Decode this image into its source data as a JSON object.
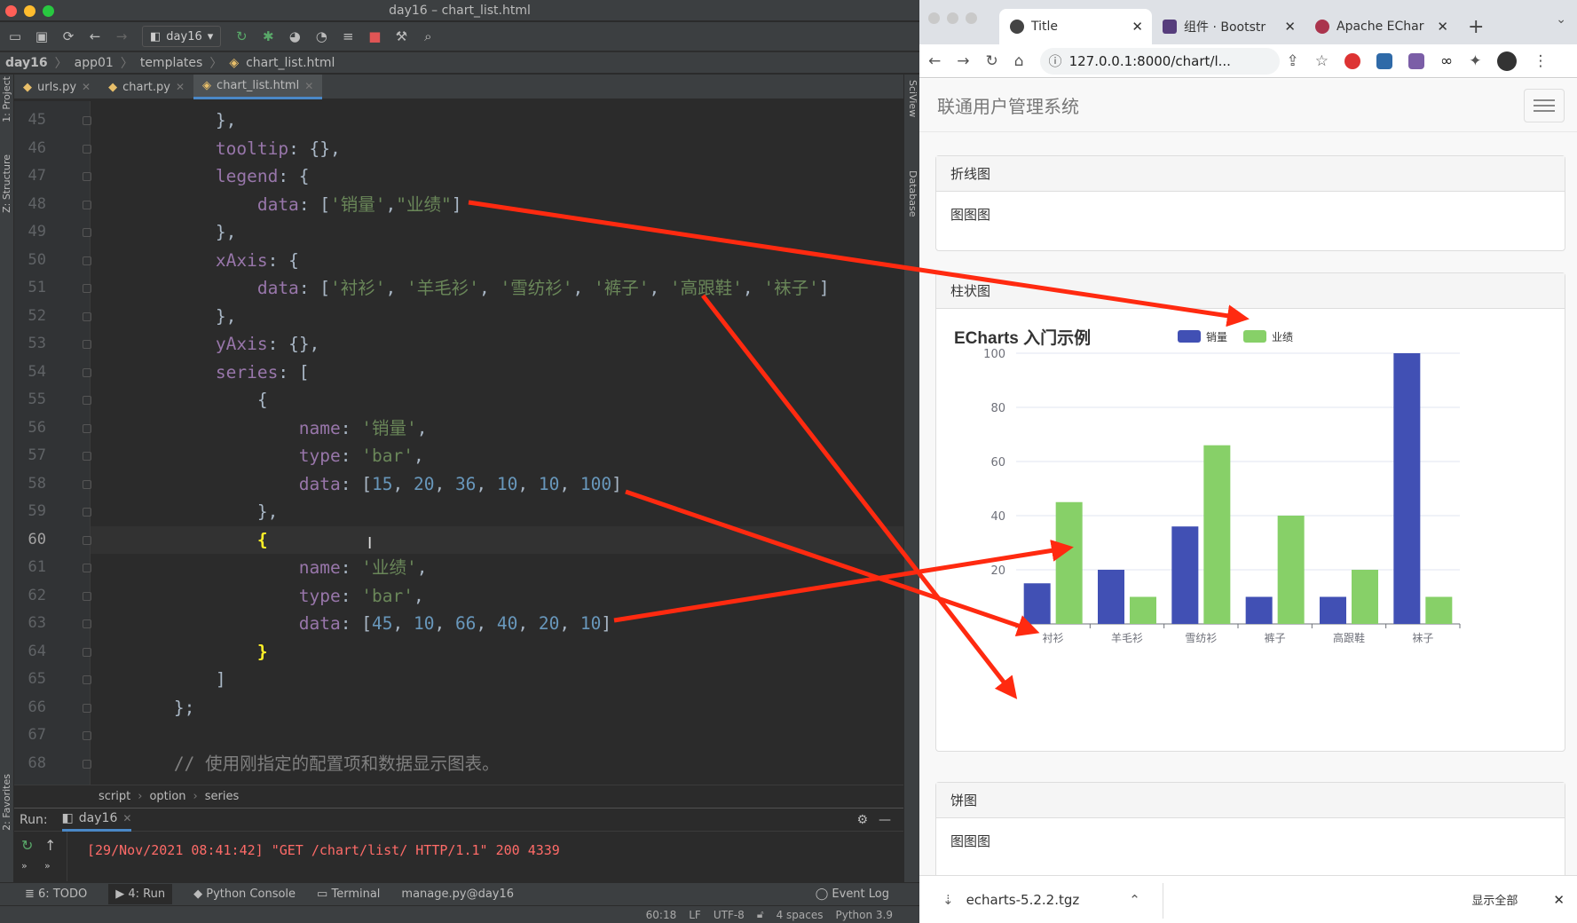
{
  "ide": {
    "window_title": "day16 – chart_list.html",
    "run_config": "day16",
    "breadcrumb": [
      "day16",
      "app01",
      "templates",
      "chart_list.html"
    ],
    "tabs": [
      {
        "label": "urls.py"
      },
      {
        "label": "chart.py"
      },
      {
        "label": "chart_list.html",
        "active": true
      }
    ],
    "left_tools": [
      "1: Project",
      "Z: Structure",
      "2: Favorites"
    ],
    "right_tools": [
      "SciView",
      "Database"
    ],
    "current_line": 60,
    "code_lines": [
      {
        "n": "45",
        "t": [
          [
            "p",
            "            },"
          ]
        ]
      },
      {
        "n": "46",
        "t": [
          [
            "k",
            "            tooltip"
          ],
          [
            "p",
            ": {},"
          ]
        ]
      },
      {
        "n": "47",
        "t": [
          [
            "k",
            "            legend"
          ],
          [
            "p",
            ": {"
          ]
        ]
      },
      {
        "n": "48",
        "t": [
          [
            "k",
            "                data"
          ],
          [
            "p",
            ": ["
          ],
          [
            "s",
            "'销量'"
          ],
          [
            "p",
            ","
          ],
          [
            "s",
            "\"业绩\""
          ],
          [
            "p",
            "]"
          ]
        ]
      },
      {
        "n": "49",
        "t": [
          [
            "p",
            "            },"
          ]
        ]
      },
      {
        "n": "50",
        "t": [
          [
            "k",
            "            xAxis"
          ],
          [
            "p",
            ": {"
          ]
        ]
      },
      {
        "n": "51",
        "t": [
          [
            "k",
            "                data"
          ],
          [
            "p",
            ": ["
          ],
          [
            "s",
            "'衬衫'"
          ],
          [
            "p",
            ", "
          ],
          [
            "s",
            "'羊毛衫'"
          ],
          [
            "p",
            ", "
          ],
          [
            "s",
            "'雪纺衫'"
          ],
          [
            "p",
            ", "
          ],
          [
            "s",
            "'裤子'"
          ],
          [
            "p",
            ", "
          ],
          [
            "s",
            "'高跟鞋'"
          ],
          [
            "p",
            ", "
          ],
          [
            "s",
            "'袜子'"
          ],
          [
            "p",
            "]"
          ]
        ]
      },
      {
        "n": "52",
        "t": [
          [
            "p",
            "            },"
          ]
        ]
      },
      {
        "n": "53",
        "t": [
          [
            "k",
            "            yAxis"
          ],
          [
            "p",
            ": {},"
          ]
        ]
      },
      {
        "n": "54",
        "t": [
          [
            "k",
            "            series"
          ],
          [
            "p",
            ": ["
          ]
        ]
      },
      {
        "n": "55",
        "t": [
          [
            "p",
            "                {"
          ]
        ]
      },
      {
        "n": "56",
        "t": [
          [
            "k",
            "                    name"
          ],
          [
            "p",
            ": "
          ],
          [
            "s",
            "'销量'"
          ],
          [
            "p",
            ","
          ]
        ]
      },
      {
        "n": "57",
        "t": [
          [
            "k",
            "                    type"
          ],
          [
            "p",
            ": "
          ],
          [
            "s",
            "'bar'"
          ],
          [
            "p",
            ","
          ]
        ]
      },
      {
        "n": "58",
        "t": [
          [
            "k",
            "                    data"
          ],
          [
            "p",
            ": ["
          ],
          [
            "n",
            "15"
          ],
          [
            "p",
            ", "
          ],
          [
            "n",
            "20"
          ],
          [
            "p",
            ", "
          ],
          [
            "n",
            "36"
          ],
          [
            "p",
            ", "
          ],
          [
            "n",
            "10"
          ],
          [
            "p",
            ", "
          ],
          [
            "n",
            "10"
          ],
          [
            "p",
            ", "
          ],
          [
            "n",
            "100"
          ],
          [
            "p",
            "]"
          ]
        ]
      },
      {
        "n": "59",
        "t": [
          [
            "p",
            "                },"
          ]
        ]
      },
      {
        "n": "60",
        "t": [
          [
            "p",
            "                "
          ],
          [
            "y",
            "{"
          ]
        ]
      },
      {
        "n": "61",
        "t": [
          [
            "k",
            "                    name"
          ],
          [
            "p",
            ": "
          ],
          [
            "s",
            "'业绩'"
          ],
          [
            "p",
            ","
          ]
        ]
      },
      {
        "n": "62",
        "t": [
          [
            "k",
            "                    type"
          ],
          [
            "p",
            ": "
          ],
          [
            "s",
            "'bar'"
          ],
          [
            "p",
            ","
          ]
        ]
      },
      {
        "n": "63",
        "t": [
          [
            "k",
            "                    data"
          ],
          [
            "p",
            ": ["
          ],
          [
            "n",
            "45"
          ],
          [
            "p",
            ", "
          ],
          [
            "n",
            "10"
          ],
          [
            "p",
            ", "
          ],
          [
            "n",
            "66"
          ],
          [
            "p",
            ", "
          ],
          [
            "n",
            "40"
          ],
          [
            "p",
            ", "
          ],
          [
            "n",
            "20"
          ],
          [
            "p",
            ", "
          ],
          [
            "n",
            "10"
          ],
          [
            "p",
            "]"
          ]
        ]
      },
      {
        "n": "64",
        "t": [
          [
            "p",
            "                "
          ],
          [
            "y",
            "}"
          ]
        ]
      },
      {
        "n": "65",
        "t": [
          [
            "p",
            "            ]"
          ]
        ]
      },
      {
        "n": "66",
        "t": [
          [
            "p",
            "        };"
          ]
        ]
      },
      {
        "n": "67",
        "t": [
          [
            "p",
            ""
          ]
        ]
      },
      {
        "n": "68",
        "t": [
          [
            "c",
            "        // 使用刚指定的配置项和数据显示图表。"
          ]
        ]
      }
    ],
    "code_breadcrumb": [
      "script",
      "option",
      "series"
    ],
    "run": {
      "label": "Run:",
      "tab": "day16",
      "log": "[29/Nov/2021 08:41:42] \"GET /chart/list/ HTTP/1.1\" 200 4339"
    },
    "bottom_tabs": [
      "6: TODO",
      "4: Run",
      "Python Console",
      "Terminal",
      "manage.py@day16"
    ],
    "event_log": "Event Log",
    "status": [
      "60:18",
      "LF",
      "UTF-8",
      "4 spaces",
      "Python 3.9"
    ]
  },
  "browser": {
    "tabs": [
      {
        "label": "Title",
        "active": true
      },
      {
        "label": "组件 · Bootstr"
      },
      {
        "label": "Apache EChar"
      }
    ],
    "url": "127.0.0.1:8000/chart/l...",
    "brand": "联通用户管理系统",
    "panels": [
      {
        "heading": "折线图",
        "body": "图图图"
      },
      {
        "heading": "柱状图"
      },
      {
        "heading": "饼图",
        "body": "图图图"
      }
    ],
    "download": {
      "file": "echarts-5.2.2.tgz",
      "show_all": "显示全部"
    }
  },
  "chart_data": {
    "type": "bar",
    "title": "ECharts 入门示例",
    "categories": [
      "衬衫",
      "羊毛衫",
      "雪纺衫",
      "裤子",
      "高跟鞋",
      "袜子"
    ],
    "series": [
      {
        "name": "销量",
        "values": [
          15,
          20,
          36,
          10,
          10,
          100
        ],
        "color": "#4150b4"
      },
      {
        "name": "业绩",
        "values": [
          45,
          10,
          66,
          40,
          20,
          10
        ],
        "color": "#87d068"
      }
    ],
    "y_ticks": [
      100,
      80,
      60,
      40,
      20
    ],
    "ylim": [
      0,
      100
    ],
    "legend_position": "top-center",
    "grid": true
  },
  "colors": {
    "annotation_arrow": "#ff2a10",
    "accent": "#4a88c7"
  }
}
